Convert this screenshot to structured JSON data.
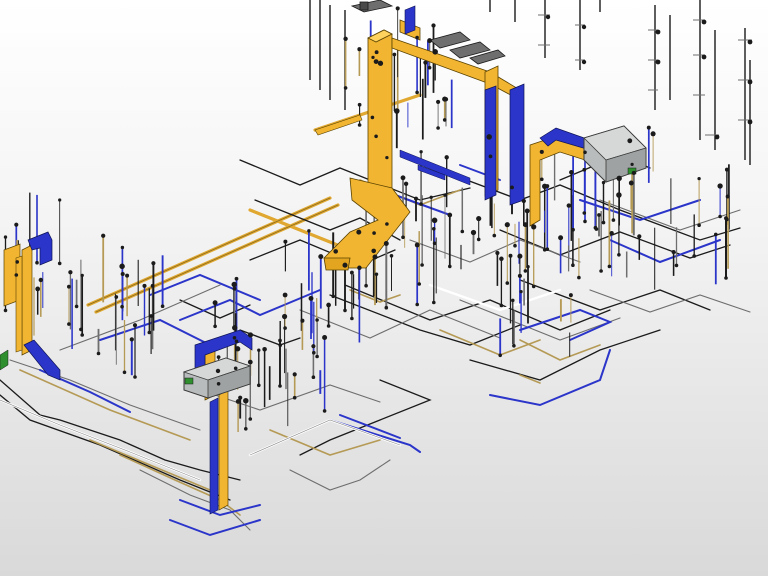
{
  "viewport": {
    "background_top": "#ffffff",
    "background_bottom": "#d9d9d9"
  },
  "palette": {
    "supply_duct": "#f2b531",
    "supply_duct_edge": "#5a4300",
    "return_duct": "#2b35c9",
    "return_duct_edge": "#0e1456",
    "pipe_dark": "#1b1b1b",
    "pipe_gray": "#6e6e6e",
    "pipe_tan": "#b59a55",
    "equipment_body": "#b9bcbc",
    "equipment_edge": "#3a3a3a",
    "connector_green": "#2f8f2f"
  },
  "model_elements": [
    {
      "name": "ahu-unit-right",
      "kind": "equipment-icon"
    },
    {
      "name": "ahu-unit-left",
      "kind": "equipment-icon"
    },
    {
      "name": "supply-duct-riser-main",
      "kind": "duct"
    },
    {
      "name": "supply-duct-riser-left",
      "kind": "duct"
    },
    {
      "name": "return-duct-riser",
      "kind": "duct"
    },
    {
      "name": "hanger-rods",
      "kind": "support"
    },
    {
      "name": "piping-network",
      "kind": "pipe"
    }
  ]
}
